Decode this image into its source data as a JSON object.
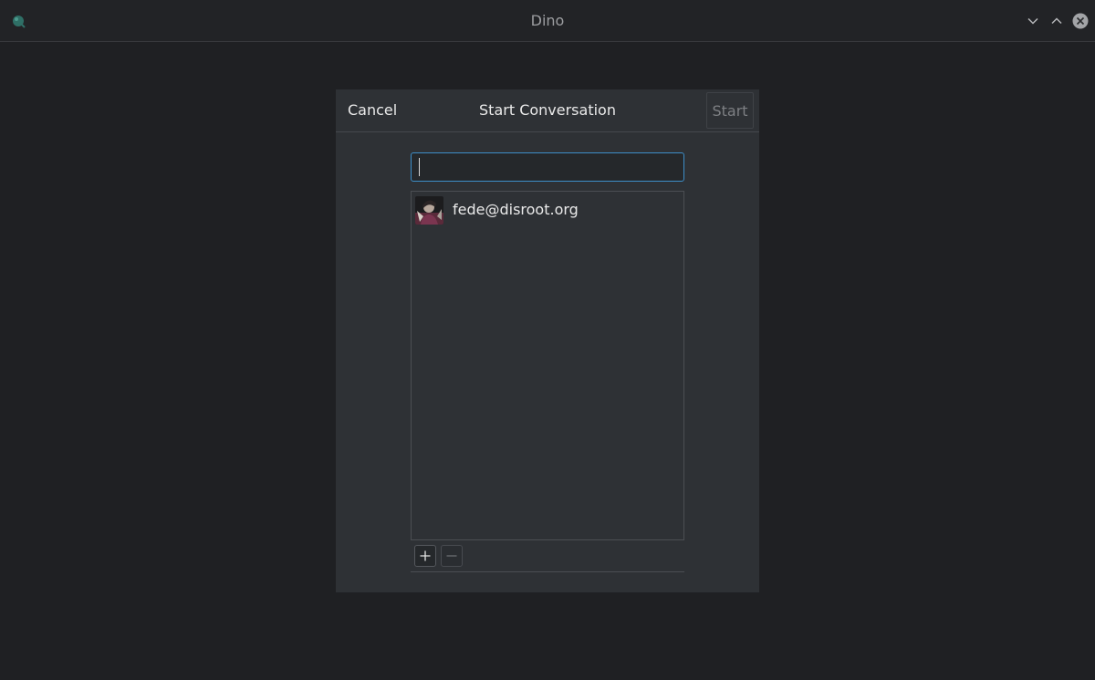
{
  "window": {
    "title": "Dino",
    "icons": {
      "app": "dino-app-icon",
      "minimize": "chevron-down-icon",
      "maximize": "chevron-up-icon",
      "close": "close-icon"
    }
  },
  "dialog": {
    "cancel_label": "Cancel",
    "title": "Start Conversation",
    "start_label": "Start",
    "search": {
      "value": "",
      "placeholder": ""
    },
    "contacts": [
      {
        "jid": "fede@disroot.org",
        "avatar": "avatar-image"
      }
    ],
    "buttons": {
      "add_icon": "plus-icon",
      "remove_icon": "minus-icon"
    }
  },
  "colors": {
    "accent": "#3d8ec9",
    "background": "#1f2023",
    "dialog": "#2e3135"
  }
}
